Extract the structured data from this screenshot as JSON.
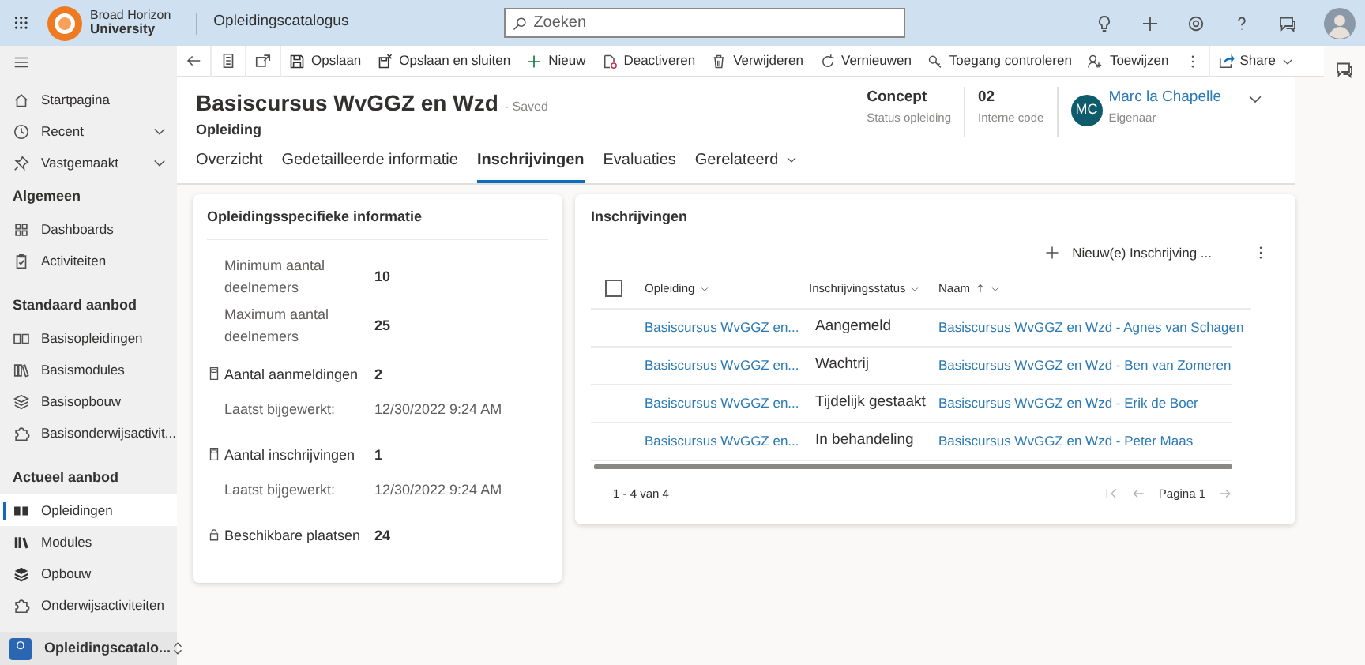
{
  "app_bar": {
    "org_name": "Broad Horizon",
    "org_sub": "University",
    "app_name": "Opleidingscatalogus",
    "search": {
      "placeholder": "Zoeken"
    }
  },
  "sidebar": {
    "sections": [
      {
        "items": [
          {
            "label": "Startpagina",
            "kind": "link",
            "selected": false
          },
          {
            "label": "Recent",
            "kind": "flyout",
            "selected": false
          },
          {
            "label": "Vastgemaakt",
            "kind": "flyout",
            "selected": false
          }
        ]
      },
      {
        "title": "Algemeen",
        "items": [
          {
            "label": "Dashboards",
            "kind": "link",
            "selected": false
          },
          {
            "label": "Activiteiten",
            "kind": "link",
            "selected": false
          }
        ]
      },
      {
        "title": "Standaard aanbod",
        "items": [
          {
            "label": "Basisopleidingen",
            "kind": "link",
            "selected": false
          },
          {
            "label": "Basismodules",
            "kind": "link",
            "selected": false
          },
          {
            "label": "Basisopbouw",
            "kind": "link",
            "selected": false
          },
          {
            "label": "Basisonderwijsactivit...",
            "kind": "link",
            "selected": false
          }
        ]
      },
      {
        "title": "Actueel aanbod",
        "items": [
          {
            "label": "Opleidingen",
            "kind": "link",
            "selected": true
          },
          {
            "label": "Modules",
            "kind": "link",
            "selected": false
          },
          {
            "label": "Opbouw",
            "kind": "link",
            "selected": false
          },
          {
            "label": "Onderwijsactiviteiten",
            "kind": "link",
            "selected": false
          }
        ]
      }
    ],
    "area": {
      "initial": "O",
      "label": "Opleidingscatalo..."
    }
  },
  "toolbar": {
    "items": [
      "Opslaan",
      "Opslaan en sluiten",
      "Nieuw",
      "Deactiveren",
      "Verwijderen",
      "Vernieuwen",
      "Toegang controleren",
      "Toewijzen"
    ],
    "share": "Share"
  },
  "record": {
    "title": "Basiscursus WvGGZ en Wzd",
    "save_status": "- Saved",
    "entity": "Opleiding",
    "fields": [
      {
        "value": "Concept",
        "label": "Status opleiding"
      },
      {
        "value": "02",
        "label": "Interne code"
      }
    ],
    "owner": {
      "initials": "MC",
      "name": "Marc la Chapelle",
      "role": "Eigenaar"
    }
  },
  "tabs": [
    {
      "label": "Overzicht",
      "kind": "tab",
      "selected": false
    },
    {
      "label": "Gedetailleerde informatie",
      "kind": "tab",
      "selected": false
    },
    {
      "label": "Inschrijvingen",
      "kind": "tab",
      "selected": true
    },
    {
      "label": "Evaluaties",
      "kind": "tab",
      "selected": false
    },
    {
      "label": "Gerelateerd",
      "kind": "menu",
      "selected": false
    }
  ],
  "info_card": {
    "title": "Opleidingsspecifieke informatie",
    "fields": [
      {
        "kind": "plain",
        "label": "Minimum aantal deelnemers",
        "value": "10"
      },
      {
        "kind": "plain",
        "label": "Maximum aantal deelnemers",
        "value": "25"
      },
      {
        "kind": "rollup",
        "label": "Aantal aanmeldingen",
        "value": "2",
        "updated_label": "Laatst bijgewerkt:",
        "updated_value": "12/30/2022 9:24 AM"
      },
      {
        "kind": "rollup",
        "label": "Aantal inschrijvingen",
        "value": "1",
        "updated_label": "Laatst bijgewerkt:",
        "updated_value": "12/30/2022 9:24 AM"
      },
      {
        "kind": "locked",
        "label": "Beschikbare plaatsen",
        "value": "24"
      }
    ]
  },
  "subgrid": {
    "title": "Inschrijvingen",
    "new_button": "Nieuw(e) Inschrijving ...",
    "select_all": {
      "checked": false
    },
    "columns": [
      {
        "label": "Opleiding",
        "sorted": false
      },
      {
        "label": "Inschrijvingsstatus",
        "sorted": false
      },
      {
        "label": "Naam",
        "sorted": true
      }
    ],
    "rows": [
      [
        "Basiscursus WvGGZ en...",
        "Aangemeld",
        "Basiscursus WvGGZ en Wzd - Agnes van Schagen"
      ],
      [
        "Basiscursus WvGGZ en...",
        "Wachtrij",
        "Basiscursus WvGGZ en Wzd - Ben van Zomeren"
      ],
      [
        "Basiscursus WvGGZ en...",
        "Tijdelijk gestaakt",
        "Basiscursus WvGGZ en Wzd - Erik de Boer"
      ],
      [
        "Basiscursus WvGGZ en...",
        "In behandeling",
        "Basiscursus WvGGZ en Wzd - Peter Maas"
      ]
    ],
    "count": "1 - 4 van 4",
    "page": "Pagina 1"
  }
}
